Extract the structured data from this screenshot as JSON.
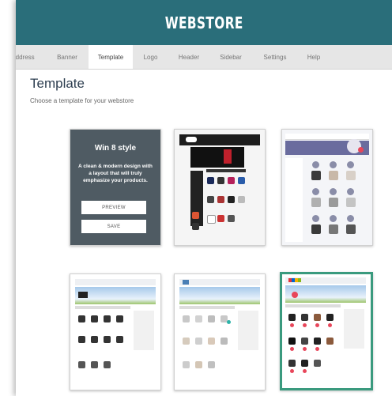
{
  "header": {
    "title": "WEBSTORE"
  },
  "tabs": [
    {
      "label": "Address"
    },
    {
      "label": "Banner"
    },
    {
      "label": "Template"
    },
    {
      "label": "Logo"
    },
    {
      "label": "Header"
    },
    {
      "label": "Sidebar"
    },
    {
      "label": "Settings"
    },
    {
      "label": "Help"
    }
  ],
  "active_tab": "Template",
  "page": {
    "title": "Template",
    "subtitle": "Choose a template for your webstore"
  },
  "templates": {
    "win8": {
      "title": "Win 8 style",
      "description": "A clean & modern design with a layout that will truly emphasize your products.",
      "preview_label": "PREVIEW",
      "save_label": "SAVE"
    },
    "selected_index": 6
  },
  "colors": {
    "header": "#2a6e7a",
    "win8_card": "#4f5b63",
    "selected_border": "#3a9a7e"
  }
}
